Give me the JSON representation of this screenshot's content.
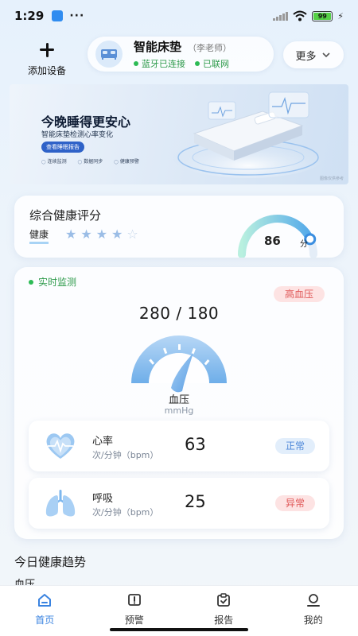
{
  "status_bar": {
    "time": "1:29",
    "dots": "···",
    "battery": "99"
  },
  "header": {
    "add_device_label": "添加设备",
    "device_name": "智能床垫",
    "device_owner": "（李老师）",
    "bluetooth_status": "蓝牙已连接",
    "network_status": "已联网",
    "more_label": "更多"
  },
  "banner": {
    "title": "今晚睡得更安心",
    "subtitle": "智能床垫检测心率变化",
    "button_label": "查看睡眠报告",
    "features": [
      "连续监测",
      "数据同步",
      "健康预警"
    ],
    "corner_text": "图像仅供参考"
  },
  "health_score": {
    "title": "综合健康评分",
    "label": "健康",
    "stars_filled": 4,
    "stars_total": 5,
    "score": "86",
    "unit": "分",
    "score_fraction": 0.86
  },
  "monitor": {
    "live_label": "实时监测",
    "alert_badge": "高血压",
    "bp_value": "280 / 180",
    "bp_label": "血压",
    "bp_unit": "mmHg",
    "metrics": [
      {
        "name": "心率",
        "unit": "次/分钟（bpm）",
        "value": "63",
        "status": "正常"
      },
      {
        "name": "呼吸",
        "unit": "次/分钟（bpm）",
        "value": "25",
        "status": "异常"
      }
    ]
  },
  "trend": {
    "title": "今日健康趋势",
    "first_chart_label": "血压"
  },
  "nav": {
    "items": [
      {
        "label": "首页",
        "active": true
      },
      {
        "label": "预警",
        "active": false
      },
      {
        "label": "报告",
        "active": false
      },
      {
        "label": "我的",
        "active": false
      }
    ]
  },
  "colors": {
    "accent": "#3a83e0",
    "ok_green": "#2dbb55",
    "alert_red": "#e05757"
  }
}
